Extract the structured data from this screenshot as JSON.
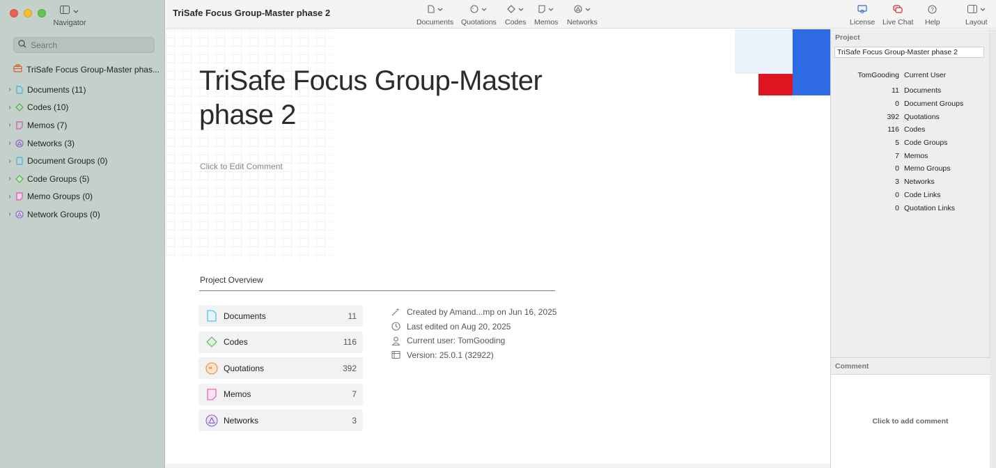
{
  "sidebar": {
    "navigator_label": "Navigator",
    "search_placeholder": "Search",
    "project_item": "TriSafe Focus Group-Master phas...",
    "tree": [
      {
        "label": "Documents (11)",
        "icon": "document-icon",
        "color": "#3ab4e8"
      },
      {
        "label": "Codes (10)",
        "icon": "code-diamond-icon",
        "color": "#52b84a"
      },
      {
        "label": "Memos (7)",
        "icon": "memo-icon",
        "color": "#d94fb0"
      },
      {
        "label": "Networks (3)",
        "icon": "network-icon",
        "color": "#8a5cc8"
      },
      {
        "label": "Document Groups (0)",
        "icon": "document-group-icon",
        "color": "#3ab4e8"
      },
      {
        "label": "Code Groups (5)",
        "icon": "code-group-icon",
        "color": "#52b84a"
      },
      {
        "label": "Memo Groups (0)",
        "icon": "memo-group-icon",
        "color": "#d94fb0"
      },
      {
        "label": "Network Groups (0)",
        "icon": "network-group-icon",
        "color": "#8a5cc8"
      }
    ]
  },
  "toolbar": {
    "title": "TriSafe Focus Group-Master phase 2",
    "documents": "Documents",
    "quotations": "Quotations",
    "codes": "Codes",
    "memos": "Memos",
    "networks": "Networks",
    "license": "License",
    "live_chat": "Live Chat",
    "help": "Help",
    "layout": "Layout"
  },
  "main": {
    "title": "TriSafe Focus Group-Master phase 2",
    "edit_comment": "Click to Edit Comment",
    "overview_title": "Project Overview",
    "stats": [
      {
        "label": "Documents",
        "value": "11",
        "icon": "document-icon"
      },
      {
        "label": "Codes",
        "value": "116",
        "icon": "code-diamond-icon"
      },
      {
        "label": "Quotations",
        "value": "392",
        "icon": "quotation-icon"
      },
      {
        "label": "Memos",
        "value": "7",
        "icon": "memo-icon"
      },
      {
        "label": "Networks",
        "value": "3",
        "icon": "network-icon"
      }
    ],
    "meta": {
      "created": "Created by Amand...mp on Jun 16, 2025",
      "edited": "Last edited on Aug 20, 2025",
      "user": "Current user: TomGooding",
      "version": "Version: 25.0.1 (32922)"
    }
  },
  "inspector": {
    "header": "Project",
    "project_name": "TriSafe Focus Group-Master phase 2",
    "user_value": "TomGooding",
    "user_label": "Current User",
    "rows": [
      {
        "value": "11",
        "label": "Documents"
      },
      {
        "value": "0",
        "label": "Document Groups"
      },
      {
        "value": "392",
        "label": "Quotations"
      },
      {
        "value": "116",
        "label": "Codes"
      },
      {
        "value": "5",
        "label": "Code Groups"
      },
      {
        "value": "7",
        "label": "Memos"
      },
      {
        "value": "0",
        "label": "Memo Groups"
      },
      {
        "value": "3",
        "label": "Networks"
      },
      {
        "value": "0",
        "label": "Code Links"
      },
      {
        "value": "0",
        "label": "Quotation Links"
      }
    ],
    "comment_header": "Comment",
    "comment_placeholder": "Click to add comment"
  },
  "colors": {
    "accent_blue": "#2d6ae4",
    "accent_red": "#e0141e",
    "sidebar_bg": "#c3d1ca"
  }
}
